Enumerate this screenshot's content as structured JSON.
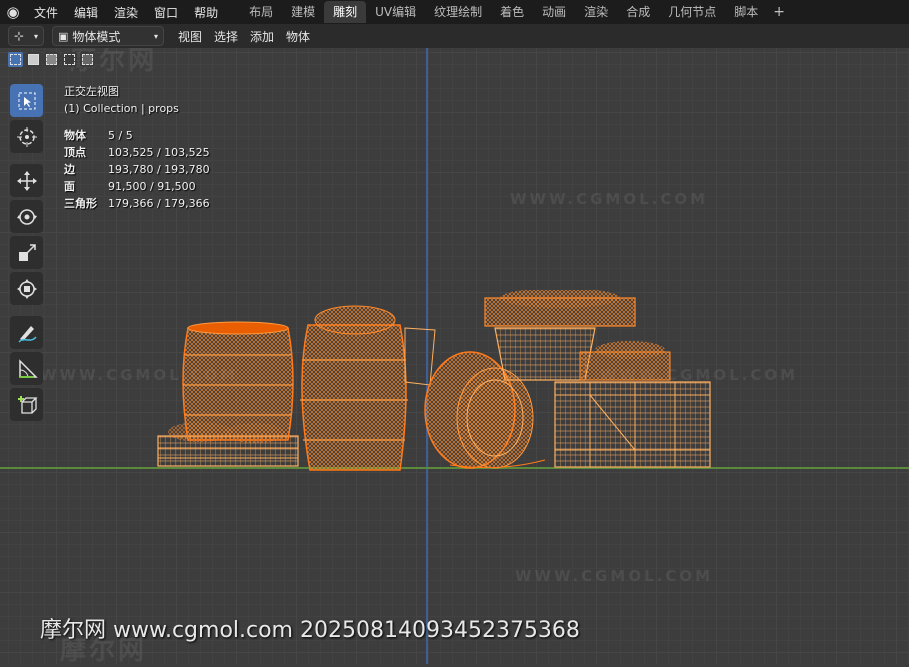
{
  "topbar": {
    "logo_icon": "blender-logo-icon",
    "menus": [
      "文件",
      "编辑",
      "渲染",
      "窗口",
      "帮助"
    ],
    "workspaces": [
      "布局",
      "建模",
      "雕刻",
      "UV编辑",
      "纹理绘制",
      "着色",
      "动画",
      "渲染",
      "合成",
      "几何节点",
      "脚本"
    ],
    "active_workspace": "雕刻",
    "add_label": "+"
  },
  "header": {
    "mode": "物体模式",
    "menus": [
      "视图",
      "选择",
      "添加",
      "物体"
    ]
  },
  "overlay": {
    "view_name": "正交左视图",
    "collection": "(1) Collection | props",
    "stats": [
      {
        "label": "物体",
        "value": "5 / 5"
      },
      {
        "label": "顶点",
        "value": "103,525 / 103,525"
      },
      {
        "label": "边",
        "value": "193,780 / 193,780"
      },
      {
        "label": "面",
        "value": "91,500 / 91,500"
      },
      {
        "label": "三角形",
        "value": "179,366 / 179,366"
      }
    ]
  },
  "toolbar": {
    "tools": [
      "select-box-icon",
      "cursor-icon",
      "move-icon",
      "rotate-icon",
      "scale-icon",
      "transform-icon",
      "annotate-icon",
      "measure-icon",
      "add-cube-icon"
    ]
  },
  "colors": {
    "wire": "#ff7a1a",
    "wire_dark": "#e85e00",
    "accent": "#4772b3"
  },
  "watermark": {
    "footer": "摩尔网 www.cgmol.com 20250814093452375368",
    "logo_text": "摩尔网",
    "site": "WWW.CGMOL.COM"
  }
}
